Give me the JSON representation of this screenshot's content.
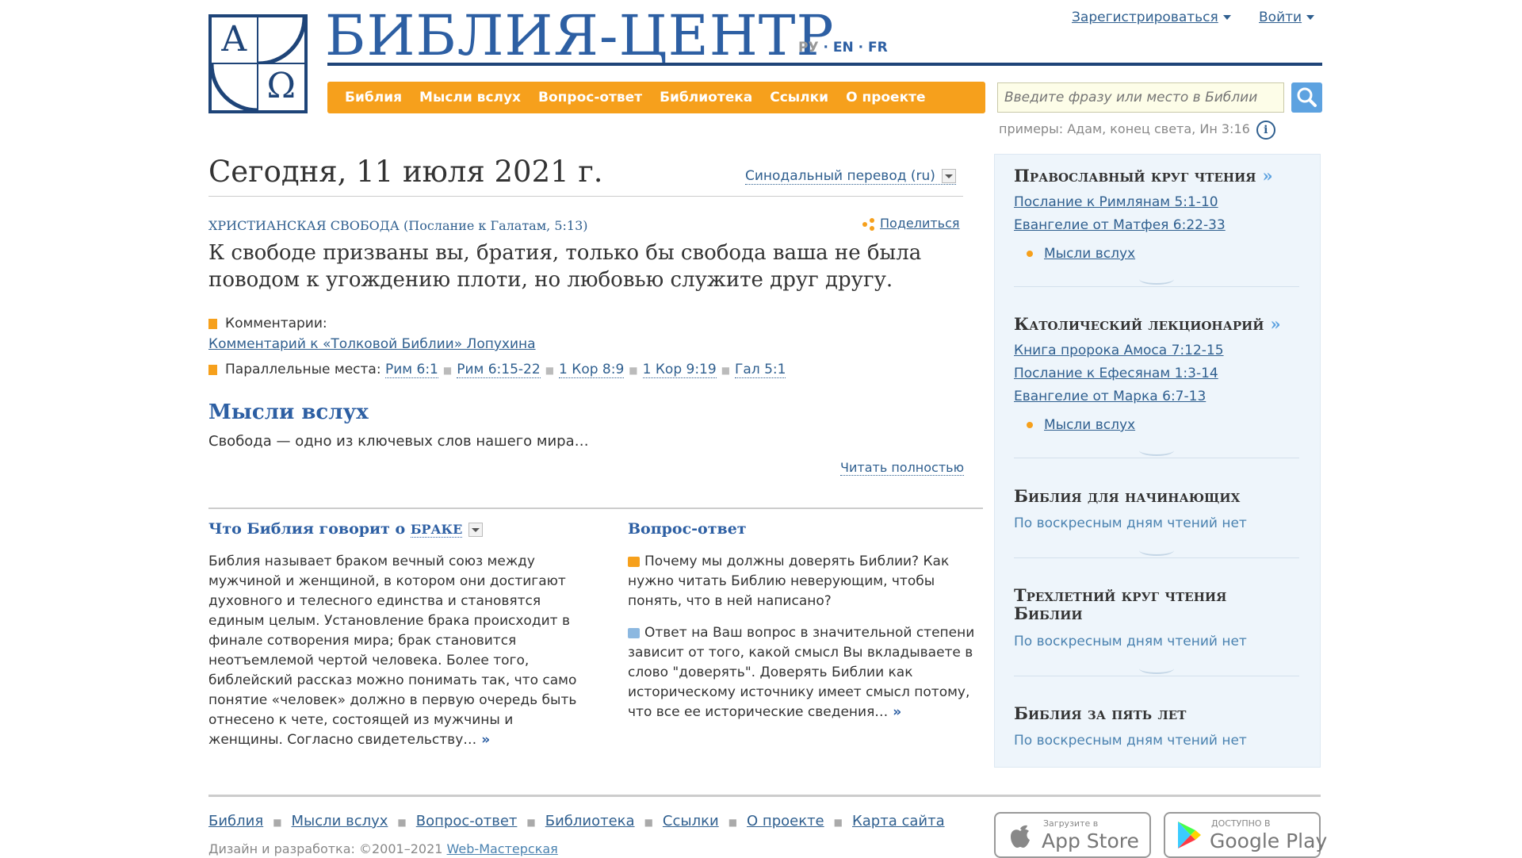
{
  "site": {
    "logo_alpha": "A",
    "logo_omega": "Ω",
    "title": "БИБЛИЯ-ЦЕНТР",
    "lang_ru": "РУ",
    "lang_en": "EN",
    "lang_fr": "FR",
    "lang_sep": "·",
    "register": "Зарегистрироваться",
    "login": "Войти"
  },
  "nav": [
    "Библия",
    "Мысли вслух",
    "Вопрос-ответ",
    "Библиотека",
    "Ссылки",
    "О проекте"
  ],
  "search": {
    "placeholder": "Введите фразу или место в Библии",
    "examples": "примеры: Адам, конец света, Ин 3:16",
    "info": "i"
  },
  "main": {
    "date": "Сегодня, 11 июля 2021 г.",
    "translation": "Синодальный перевод (ru)",
    "verse_title": "Христианская свобода",
    "verse_source": "(Послание к Галатам, 5:13)",
    "share": "Поделиться",
    "verse_text": "К свободе призваны вы, братия, только бы свобода ваша не была поводом к угождению плоти, но любовью служите друг другу.",
    "comments_label": "Комментарии:",
    "comments_link": "Комментарий к «Толковой Библии» Лопухина",
    "parallels_label": "Параллельные места:",
    "parallels": [
      "Рим 6:1",
      "Рим 6:15-22",
      "1 Кор 8:9",
      "1 Кор 9:19",
      "Гал 5:1"
    ],
    "thoughts_heading": "Мысли вслух",
    "thoughts_text": "Свобода — одно из ключевых слов нашего мира…",
    "read_more": "Читать полностью"
  },
  "marriage": {
    "heading_prefix": "Что Библия говорит о",
    "heading_keyword": "браке",
    "text": "Библия называет браком вечный союз между мужчиной и женщиной, в котором они достигают духовного и телесного единства и становятся единым целым. Установление брака происходит в финале сотворения мира; брак становится неотъемлемой чертой человека. Более того, библейский рассказ можно понимать так, что само понятие «человек» должно в первую очередь быть отнесено к чете, состоящей из мужчины и женщины. Согласно свидетельству…",
    "more": "»"
  },
  "qa": {
    "heading": "Вопрос-ответ",
    "question": "Почему мы должны доверять Библии? Как нужно читать Библию неверующим, чтобы понять, что в ней написано?",
    "answer": "Ответ на Ваш вопрос в значительной степени зависит от того, какой смысл Вы вкладываете в слово \"доверять\". Доверять Библии как историческому источнику имеет смысл потому, что все ее исторические сведения…",
    "more": "»"
  },
  "sidebar": {
    "orthodox": {
      "heading": "Православный круг чтения",
      "arrow": "»",
      "links": [
        "Послание к Римлянам 5:1-10",
        "Евангелие от Матфея 6:22-33"
      ],
      "thoughts": "Мысли вслух"
    },
    "catholic": {
      "heading": "Католический лекционарий",
      "arrow": "»",
      "links": [
        "Книга пророка Амоса 7:12-15",
        "Послание к Ефесянам 1:3-14",
        "Евангелие от Марка 6:7-13"
      ],
      "thoughts": "Мысли вслух"
    },
    "beginners": {
      "heading": "Библия для начинающих",
      "text": "По воскресным дням чтений нет"
    },
    "three_year": {
      "heading_line1": "Трехлетний круг чтения",
      "heading_line2": "Библии",
      "text": "По воскресным дням чтений нет"
    },
    "five_years": {
      "heading": "Библия за пять лет",
      "text": "По воскресным дням чтений нет"
    }
  },
  "footer": {
    "links": [
      "Библия",
      "Мысли вслух",
      "Вопрос-ответ",
      "Библиотека",
      "Ссылки",
      "О проекте",
      "Карта сайта"
    ],
    "credits_prefix": "Дизайн и разработка:  ©2001–2021",
    "credits_link": "Web-Мастерская",
    "appstore_small": "Загрузите в",
    "appstore_big": "App Store",
    "googleplay_small": "ДОСТУПНО В",
    "googleplay_big": "Google Play"
  },
  "colors": {
    "brand_blue": "#1e4478",
    "title_blue": "#2d5fa3",
    "nav_orange": "#f6a01c",
    "search_button": "#5da2e0",
    "sidebar_bg": "#eef5fb"
  }
}
